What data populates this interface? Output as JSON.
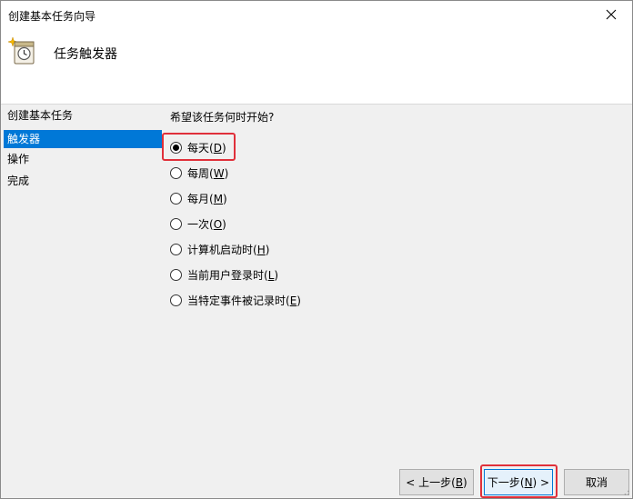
{
  "window": {
    "title": "创建基本任务向导"
  },
  "header": {
    "icon": "task-scheduler-icon",
    "title": "任务触发器"
  },
  "sidebar": {
    "items": [
      {
        "label": "创建基本任务",
        "active": false
      },
      {
        "label": "触发器",
        "active": true
      },
      {
        "label": "操作",
        "active": false
      },
      {
        "label": "完成",
        "active": false
      }
    ]
  },
  "content": {
    "question": "希望该任务何时开始?",
    "options": [
      {
        "text": "每天(",
        "key": "D",
        "checked": true
      },
      {
        "text": "每周(",
        "key": "W",
        "checked": false
      },
      {
        "text": "每月(",
        "key": "M",
        "checked": false
      },
      {
        "text": "一次(",
        "key": "O",
        "checked": false
      },
      {
        "text": "计算机启动时(",
        "key": "H",
        "checked": false
      },
      {
        "text": "当前用户登录时(",
        "key": "L",
        "checked": false
      },
      {
        "text": "当特定事件被记录时(",
        "key": "E",
        "checked": false
      }
    ]
  },
  "buttons": {
    "back": {
      "prefix": "< 上一步(",
      "key": "B",
      "suffix": ")"
    },
    "next": {
      "prefix": "下一步(",
      "key": "N",
      "suffix": ") >"
    },
    "cancel": "取消"
  },
  "colors": {
    "accent": "#0078d7",
    "highlight": "#e0303a"
  }
}
